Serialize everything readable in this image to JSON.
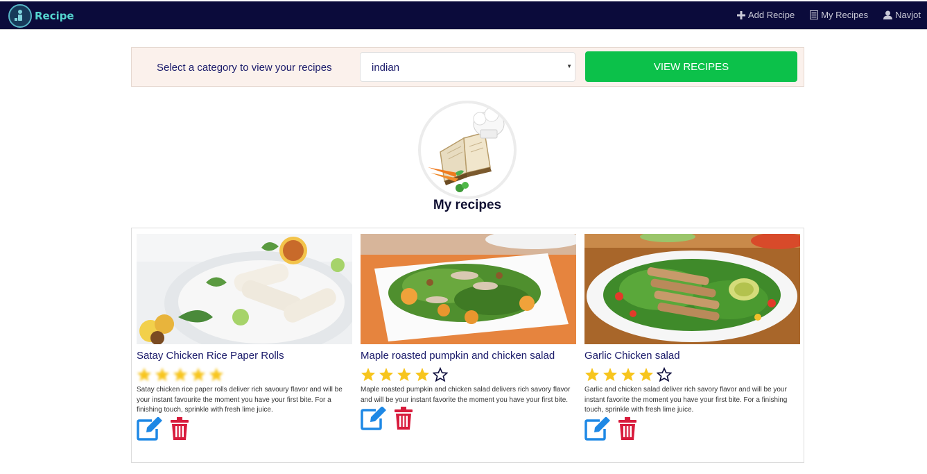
{
  "navbar": {
    "brand": "Recipe",
    "links": [
      {
        "label": "Add Recipe",
        "icon": "plus-icon"
      },
      {
        "label": "My Recipes",
        "icon": "list-icon"
      },
      {
        "label": "Navjot",
        "icon": "user-icon"
      }
    ]
  },
  "filter": {
    "label": "Select a category to view your recipes",
    "selected_category": "indian",
    "button_label": "VIEW RECIPES"
  },
  "page": {
    "title": "My recipes"
  },
  "recipes": [
    {
      "title": "Satay Chicken Rice Paper Rolls",
      "rating": 5,
      "description": "Satay chicken rice paper rolls deliver rich savoury flavor and will be your instant favourite the moment you have your first bite. For a finishing touch, sprinkle with fresh lime juice."
    },
    {
      "title": "Maple roasted pumpkin and chicken salad",
      "rating": 4,
      "description": "Maple roasted pumpkin and chicken salad delivers rich savory flavor and will be your instant favorite the moment you have your first bite."
    },
    {
      "title": "Garlic Chicken salad",
      "rating": 4,
      "description": "Garlic and chicken salad deliver rich savory flavor and will be your instant favorite the moment you have your first bite. For a finishing touch, sprinkle with fresh lime juice."
    }
  ],
  "colors": {
    "navbar_bg": "#0b0b3b",
    "button_green": "#0cc14a",
    "star_gold": "#f7c51e",
    "edit_blue": "#1e88e5",
    "delete_red": "#d81b3c"
  }
}
